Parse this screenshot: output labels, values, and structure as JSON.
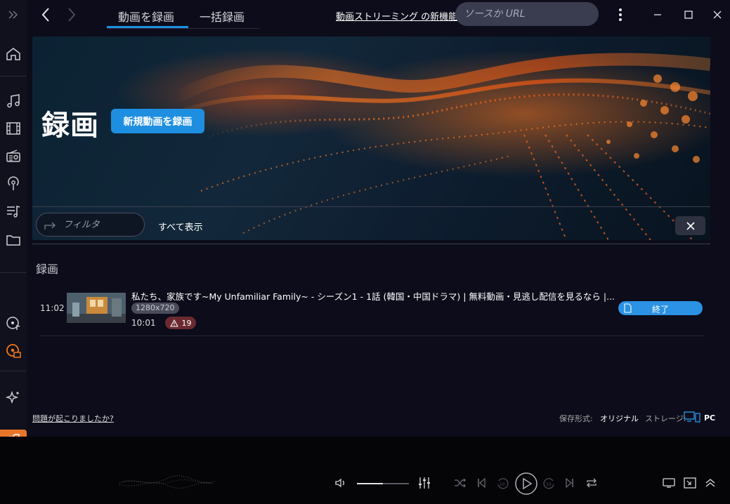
{
  "nav": {
    "tabs": [
      {
        "label": "動画を録画",
        "active": true
      },
      {
        "label": "一括録画",
        "active": false
      }
    ],
    "promo_link": "動画ストリーミング の新機能",
    "search_placeholder": "ソースか URL"
  },
  "banner": {
    "title": "録画",
    "new_record_button": "新規動画を録画"
  },
  "filter": {
    "placeholder": "フィルタ",
    "show_all": "すべて表示"
  },
  "section": {
    "label": "録画"
  },
  "recordings": [
    {
      "time": "11:02",
      "title": "私たち、家族です~My Unfamiliar Family~ - シーズン1 - 1話 (韓国・中国ドラマ) | 無料動画・見逃し配信を見るなら |...",
      "resolution": "1280x720",
      "duration": "10:01",
      "warnings": "19",
      "status": "終了"
    }
  ],
  "footer": {
    "help_link": "問題が起こりましたか?",
    "save_format_label": "保存形式:",
    "save_format_value": "オリジナル",
    "storage_label": "ストレージ:",
    "storage_value": "PC"
  },
  "player": {
    "volume_level": 0.5
  },
  "colors": {
    "accent": "#1e8fe0",
    "sidebar_bg": "#11111d",
    "main_bg": "#0c0c1a",
    "player_bg": "#050508",
    "warning_badge": "#6a2a30",
    "record_active_icon": "#f07a1a"
  }
}
